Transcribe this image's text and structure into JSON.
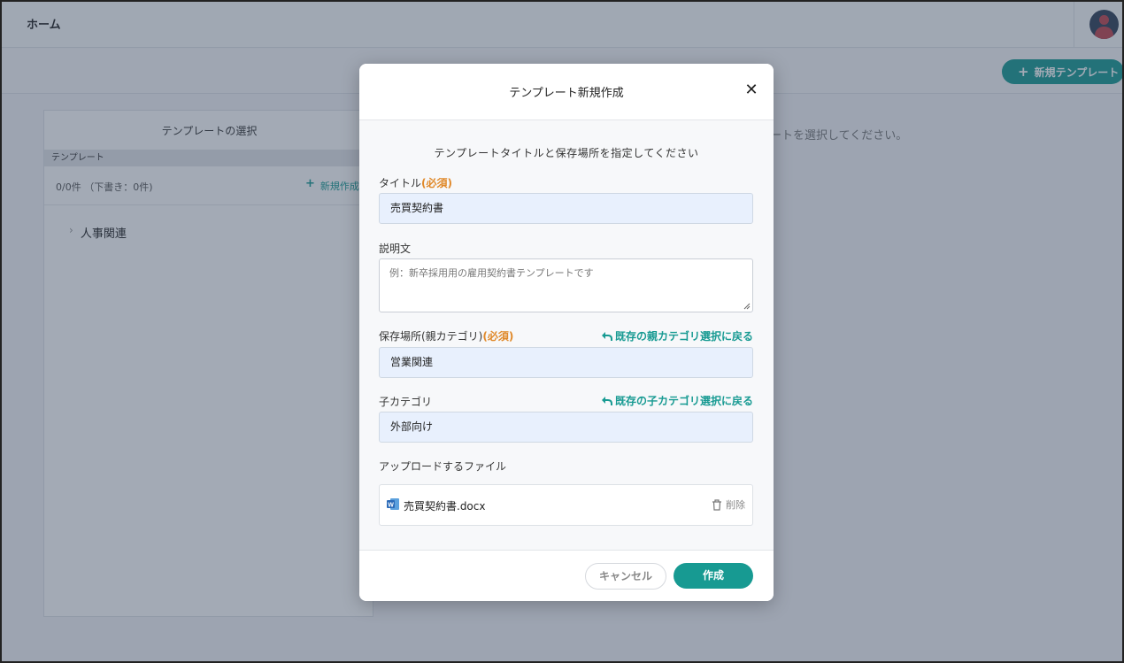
{
  "header": {
    "home_label": "ホーム"
  },
  "toolbar": {
    "new_template_label": "新規テンプレート"
  },
  "template_panel": {
    "title": "テンプレートの選択",
    "section_label": "テンプレート",
    "count_text": "0/0件 （下書き：0件)",
    "new_label": "新規作成",
    "tree_items": [
      {
        "label": "人事関連"
      }
    ]
  },
  "main_message": "ートを選択してください。",
  "modal": {
    "title": "テンプレート新規作成",
    "instruction": "テンプレートタイトルと保存場所を指定してください",
    "title_field": {
      "label": "タイトル",
      "required": "(必須)",
      "value": "売買契約書"
    },
    "description_field": {
      "label": "説明文",
      "placeholder": "例：新卒採用用の雇用契約書テンプレートです"
    },
    "parent_category_field": {
      "label": "保存場所(親カテゴリ)",
      "required": "(必須)",
      "back_link": "既存の親カテゴリ選択に戻る",
      "value": "営業関連"
    },
    "child_category_field": {
      "label": "子カテゴリ",
      "back_link": "既存の子カテゴリ選択に戻る",
      "value": "外部向け"
    },
    "upload": {
      "label": "アップロードするファイル",
      "file_name": "売買契約書.docx",
      "delete_label": "削除"
    },
    "cancel_label": "キャンセル",
    "create_label": "作成"
  },
  "colors": {
    "accent": "#179a92",
    "required": "#e0892a",
    "input_bg": "#e8f0fd"
  }
}
